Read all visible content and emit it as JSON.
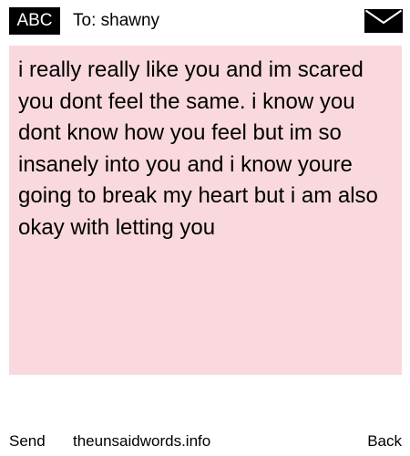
{
  "header": {
    "mode_label": "ABC",
    "to_label": "To: shawny"
  },
  "message": {
    "text": "i really really like you and im scared you dont feel the same. i know you dont know how you feel but im so insanely into you and i know youre going to break my heart but i am also okay with letting you"
  },
  "footer": {
    "send_label": "Send",
    "site_label": "theunsaidwords.info",
    "back_label": "Back"
  },
  "colors": {
    "message_background": "#f9d9dd",
    "badge_background": "#000000"
  },
  "icons": {
    "envelope": "envelope-icon"
  }
}
